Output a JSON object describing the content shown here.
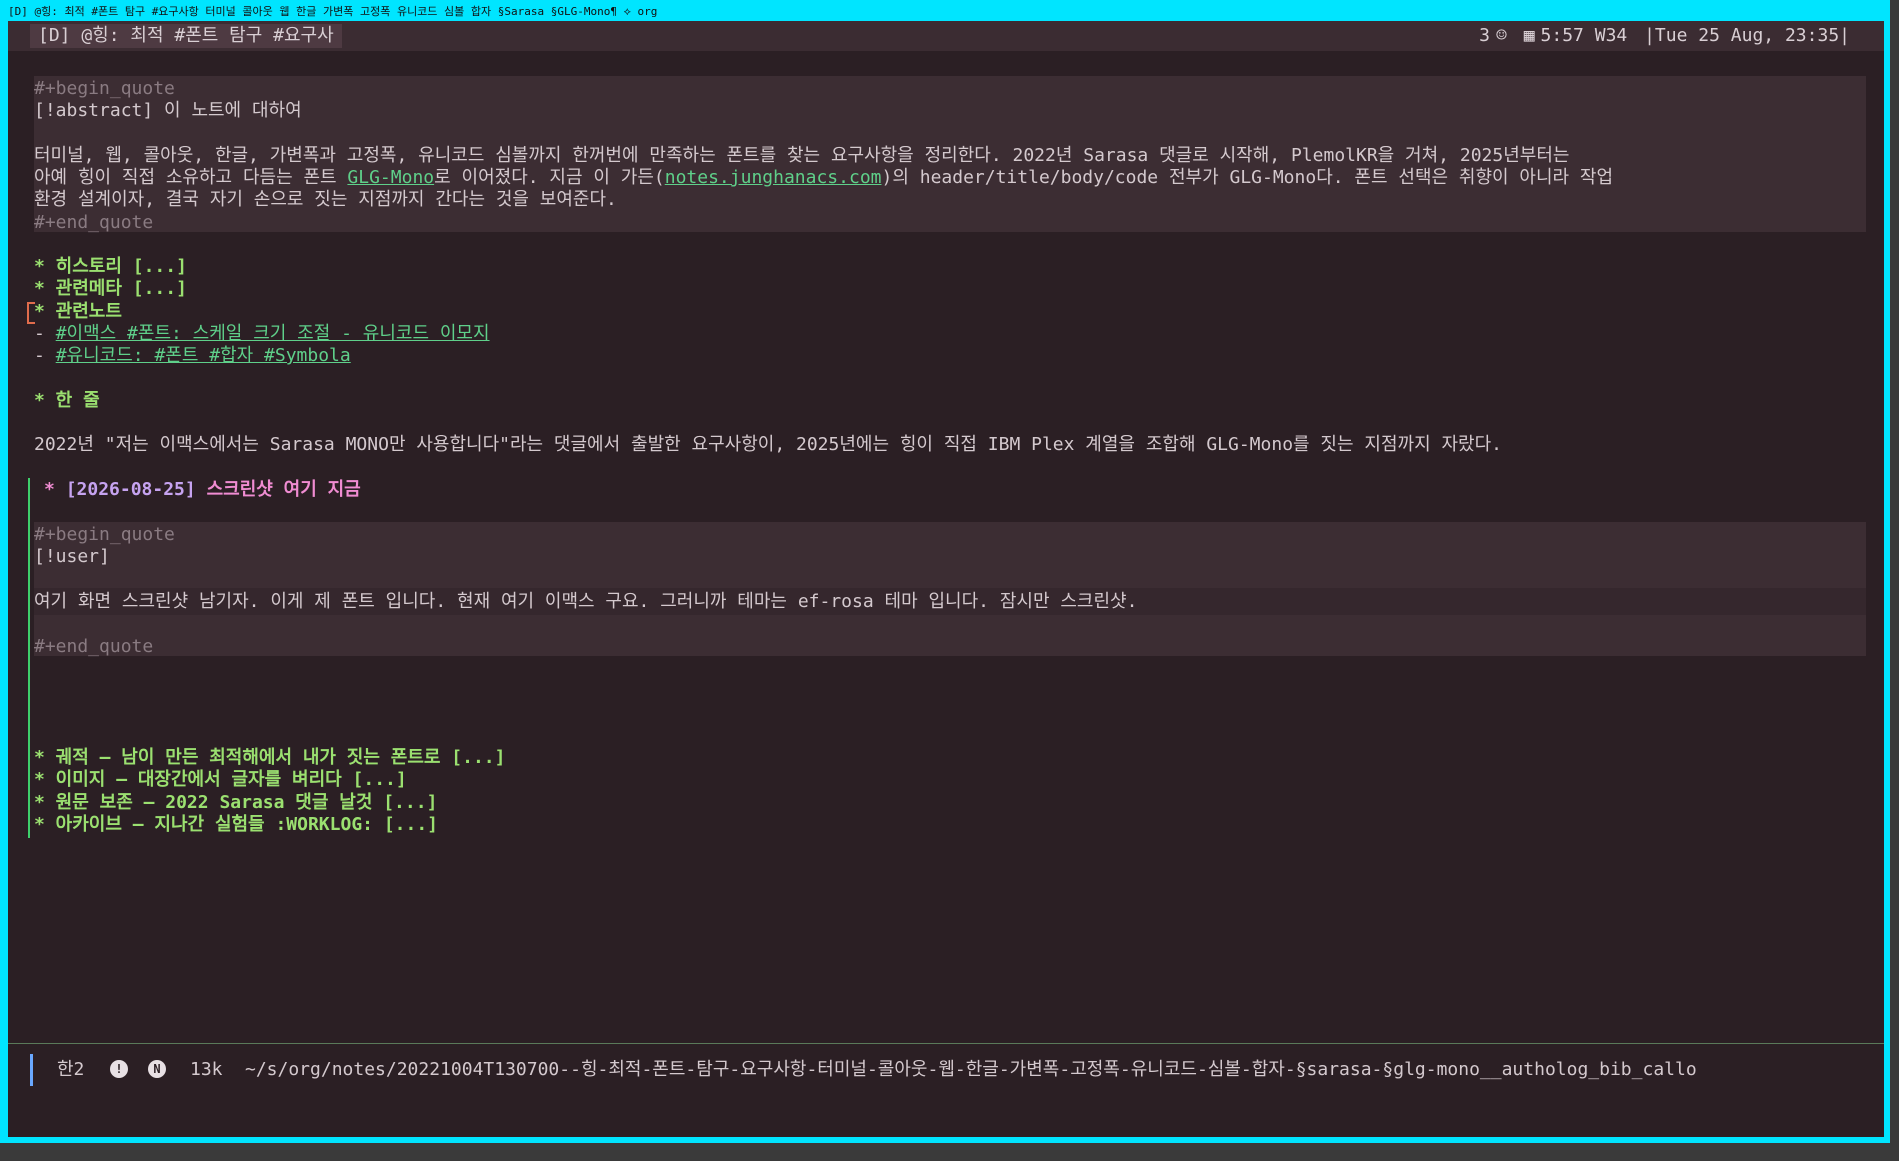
{
  "window": {
    "wm_title": "[D] @힝: 최적 #폰트 탐구 #요구사항 터미널 콜아웃 웹 한글 가변폭 고정폭 유니코드 심볼 합자 §Sarasa §GLG-Mono¶ ⟡ org"
  },
  "tabbar": {
    "tab_title": "[D] @힝: 최적 #폰트 탐구 #요구사",
    "count": "3",
    "time_info": "5:57 W34",
    "date": "|Tue 25 Aug, 23:35|"
  },
  "abstract": {
    "begin": "#+begin_quote",
    "title": "[!abstract] 이 노트에 대하여",
    "line1": "터미널, 웹, 콜아웃, 한글, 가변폭과 고정폭, 유니코드 심볼까지 한꺼번에 만족하는 폰트를 찾는 요구사항을 정리한다. 2022년 Sarasa 댓글로 시작해, PlemolKR을 거쳐, 2025년부터는",
    "line2_a": "아예 힝이 직접 소유하고 다듬는 폰트 ",
    "line2_link1": "GLG-Mono",
    "line2_b": "로 이어졌다. 지금 이 가든(",
    "line2_link2": "notes.junghanacs.com",
    "line2_c": ")의 header/title/body/code 전부가 GLG-Mono다. 폰트 선택은 취향이 아니라 작업",
    "line3": "환경 설계이자, 결국 자기 손으로 짓는 지점까지 간다는 것을 보여준다.",
    "end": "#+end_quote"
  },
  "headings_top": [
    "* 히스토리 [...]",
    "* 관련메타 [...]",
    "* 관련노트"
  ],
  "related_links": [
    "#이맥스 #폰트: 스케일 크기 조절 - 유니코드 이모지",
    "#유니코드: #폰트 #합자 #Symbola"
  ],
  "one_line": {
    "heading": "* 한 줄",
    "body": "2022년 \"저는 이맥스에서는 Sarasa MONO만 사용합니다\"라는 댓글에서 출발한 요구사항이, 2025년에는 힝이 직접 IBM Plex 계열을 조합해 GLG-Mono를 짓는 지점까지 자랐다."
  },
  "screenshot_section": {
    "star": "*",
    "date": "[2026-08-25]",
    "title": "스크린샷 여기 지금",
    "begin": "#+begin_quote",
    "user": "[!user]",
    "body": "여기 화면 스크린샷 남기자. 이게 제 폰트 입니다. 현재 여기 이맥스 구요. 그러니까 테마는 ef-rosa 테마 입니다. 잠시만 스크린샷.",
    "end": "#+end_quote"
  },
  "headings_bottom": [
    "* 궤적 — 남이 만든 최적해에서 내가 짓는 폰트로 [...]",
    "* 이미지 — 대장간에서 글자를 벼리다 [...]",
    "* 원문 보존 — 2022 Sarasa 댓글 날것 [...]",
    "* 아카이브 — 지나간 실험들 :WORKLOG: [...]"
  ],
  "modeline": {
    "input_method": "한2",
    "info_icon": "!",
    "n_icon": "N",
    "size": "13k",
    "path": "~/s/org/notes/20221004T130700--힝-최적-폰트-탐구-요구사항-터미널-콜아웃-웹-한글-가변폭-고정폭-유니코드-심볼-합자-§sarasa-§glg-mono__autholog_bib_callo"
  },
  "colors": {
    "background": "#2b1f24",
    "heading": "#9be070",
    "heading_pink": "#f08cd2",
    "link": "#5fd08a",
    "window_border": "#00e5ff"
  }
}
